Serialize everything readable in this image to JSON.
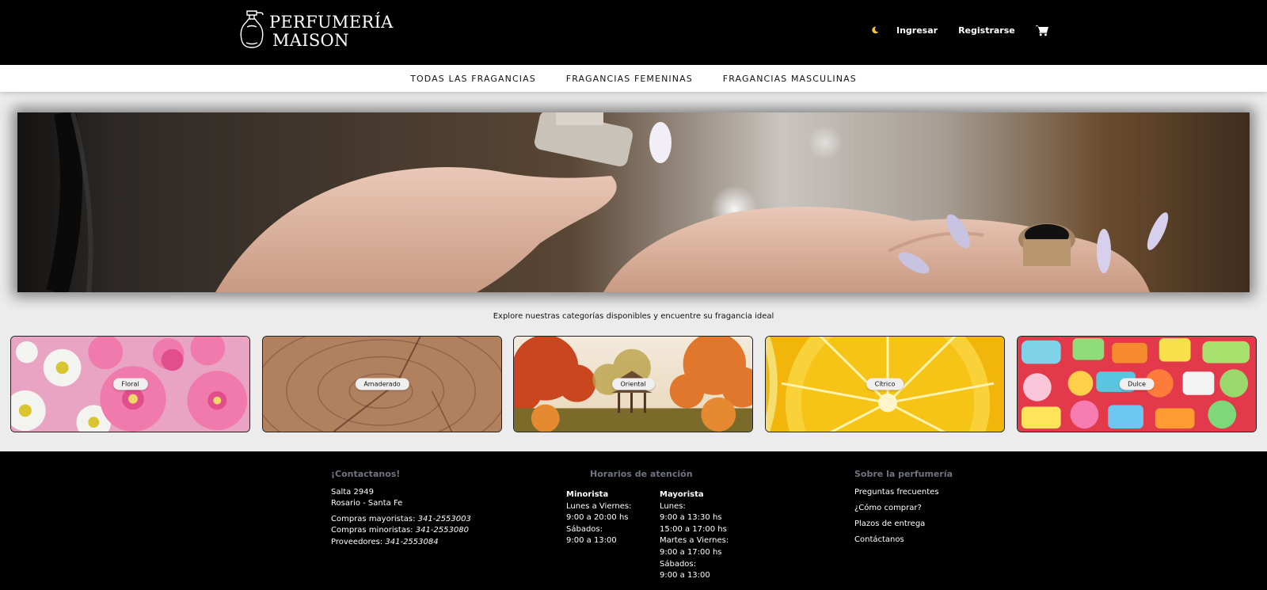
{
  "header": {
    "logo_line1": "PERFUMERÍA",
    "logo_line2": "MAISON",
    "theme_toggle_icon": "moon-icon",
    "login_label": "Ingresar",
    "register_label": "Registrarse",
    "cart_icon": "cart-icon",
    "colors": {
      "background": "#000000",
      "text": "#ffffff",
      "moon": "#f5c542"
    }
  },
  "nav": {
    "items": [
      {
        "label": "TODAS LAS FRAGANCIAS"
      },
      {
        "label": "FRAGANCIAS FEMENINAS"
      },
      {
        "label": "FRAGANCIAS MASCULINAS"
      }
    ]
  },
  "hero": {
    "image": "hands-applying-perfume-photo"
  },
  "categories": {
    "intro": "Explore nuestras categorías disponibles y encuentre su fragancia ideal",
    "items": [
      {
        "label": "Floral",
        "image": "flowers-photo"
      },
      {
        "label": "Amaderado",
        "image": "wood-rings-photo"
      },
      {
        "label": "Oriental",
        "image": "autumn-pagoda-photo"
      },
      {
        "label": "Cítrico",
        "image": "lemon-slice-photo"
      },
      {
        "label": "Dulce",
        "image": "candies-photo"
      }
    ]
  },
  "footer": {
    "contact": {
      "heading": "¡Contactanos!",
      "address_line1": "Salta 2949",
      "address_line2": "Rosario - Santa Fe",
      "wholesale_label": "Compras mayoristas:",
      "wholesale_phone": "341-2553003",
      "retail_label": "Compras minoristas:",
      "retail_phone": "341-2553080",
      "suppliers_label": "Proveedores:",
      "suppliers_phone": "341-2553084"
    },
    "hours": {
      "heading": "Horarios de atención",
      "retail": {
        "title": "Minorista",
        "lines": [
          "Lunes a Viernes:",
          "9:00 a 20:00 hs",
          "Sábados:",
          "9:00 a 13:00"
        ]
      },
      "wholesale": {
        "title": "Mayorista",
        "lines": [
          "Lunes:",
          "9:00 a 13:30 hs",
          "15:00 a 17:00 hs",
          "Martes a Viernes:",
          "9:00 a 17:00 hs",
          "Sábados:",
          "9:00 a 13:00"
        ]
      }
    },
    "about": {
      "heading": "Sobre la perfumería",
      "links": [
        "Preguntas frecuentes",
        "¿Cómo comprar?",
        "Plazos de entrega",
        "Contáctanos"
      ]
    },
    "colors": {
      "background": "#000000",
      "heading": "#6f7480",
      "text": "#ffffff"
    }
  }
}
